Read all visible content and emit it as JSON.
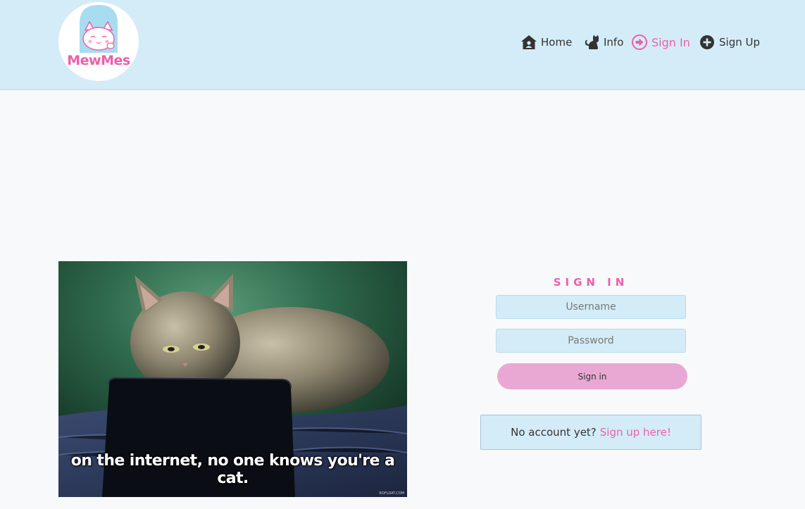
{
  "brand": {
    "logo_text": "MewMes"
  },
  "nav": {
    "home": "Home",
    "info": "Info",
    "signin": "Sign In",
    "signup": "Sign Up"
  },
  "hero_image": {
    "caption": "on the internet, no one knows you're a cat.",
    "credit": "ROFLOAT.COM"
  },
  "signin_form": {
    "title": "SIGN IN",
    "username_placeholder": "Username",
    "password_placeholder": "Password",
    "submit_label": "Sign in",
    "no_account_text": "No account yet?",
    "signup_link": "Sign up here!"
  },
  "colors": {
    "accent_pink": "#ee5faa",
    "navbar_bg": "#d4ecf8",
    "button_pink": "#e9a8d4"
  },
  "icons": {
    "home": "house-user-icon",
    "info": "cat-icon",
    "signin": "circle-arrow-right-icon",
    "signup": "circle-plus-icon"
  }
}
